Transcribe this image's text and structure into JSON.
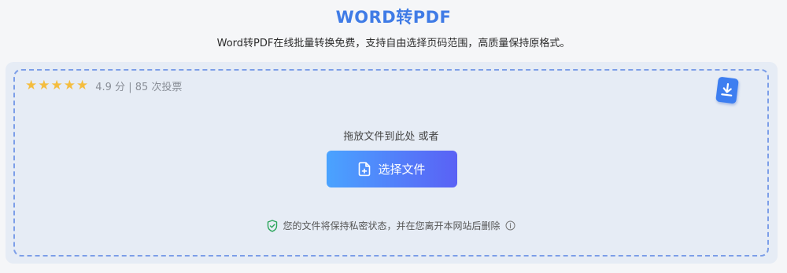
{
  "header": {
    "title": "WORD转PDF",
    "subtitle": "Word转PDF在线批量转换免费，支持自由选择页码范围，高质量保持原格式。"
  },
  "rating": {
    "stars": 5,
    "text": "4.9 分 | 85 次投票"
  },
  "upload": {
    "drop_hint": "拖放文件到此处 或者",
    "choose_button_label": "选择文件",
    "privacy_text": "您的文件将保持私密状态，并在您离开本网站后删除"
  },
  "icons": {
    "star": "star-icon",
    "download": "download-icon",
    "file_add": "file-add-icon",
    "shield": "shield-check-icon",
    "info": "info-icon"
  },
  "colors": {
    "title": "#3f7be6",
    "star": "#f4bd3f",
    "card_bg": "#e6ecf5",
    "dashed_border": "#7c9ee8",
    "button_gradient_start": "#4aa3ff",
    "button_gradient_end": "#5a61f5",
    "shield": "#2aa55a"
  }
}
